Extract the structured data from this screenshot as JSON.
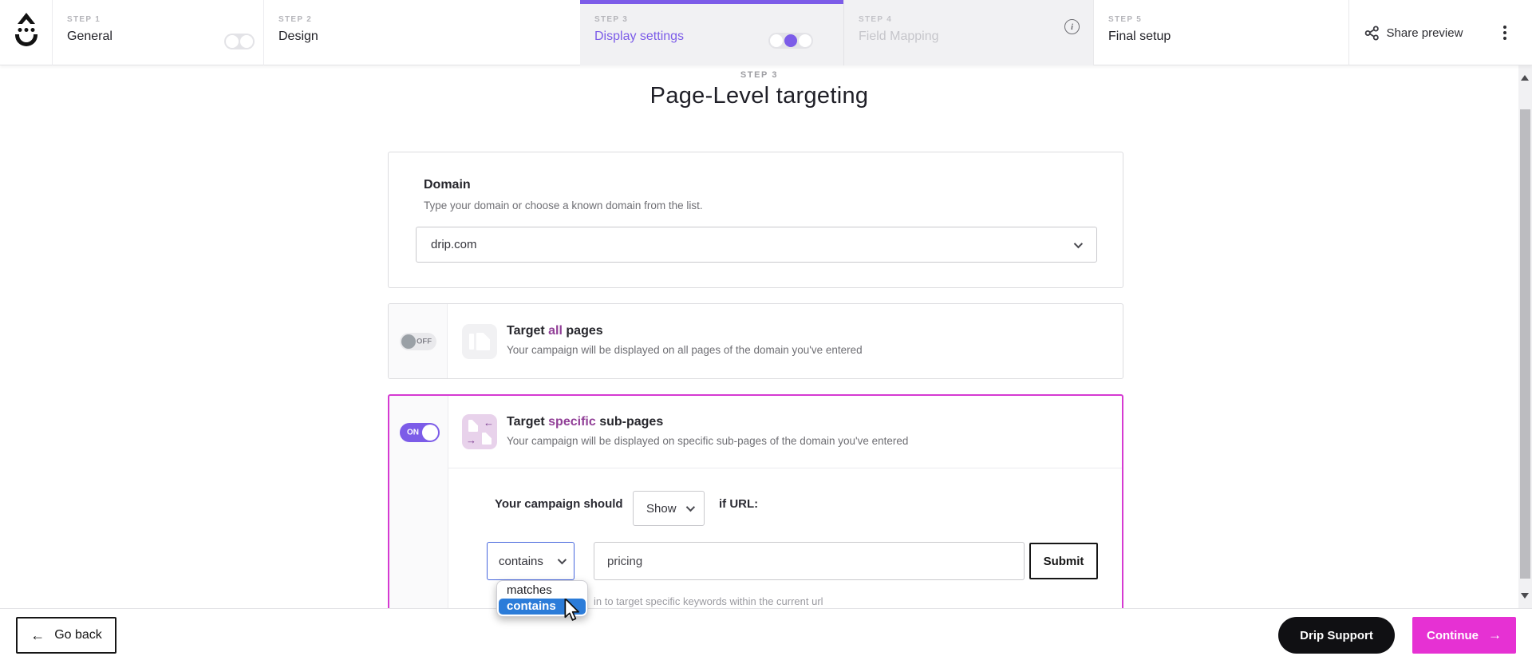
{
  "header": {
    "steps": [
      {
        "step": "STEP 1",
        "label": "General"
      },
      {
        "step": "STEP 2",
        "label": "Design"
      },
      {
        "step": "STEP 3",
        "label": "Display settings"
      },
      {
        "step": "STEP 4",
        "label": "Field Mapping"
      },
      {
        "step": "STEP 5",
        "label": "Final setup"
      }
    ],
    "share_preview_label": "Share preview"
  },
  "page": {
    "step_eyebrow": "STEP 3",
    "title": "Page-Level targeting"
  },
  "domain_card": {
    "title": "Domain",
    "description": "Type your domain or choose a known domain from the list.",
    "selected_domain": "drip.com"
  },
  "all_pages_card": {
    "toggle_state": "OFF",
    "title_prefix": "Target ",
    "title_highlight": "all",
    "title_suffix": " pages",
    "description": "Your campaign will be displayed on all pages of the domain you've entered"
  },
  "specific_pages_card": {
    "toggle_state": "ON",
    "title_prefix": "Target ",
    "title_highlight": "specific",
    "title_suffix": " sub-pages",
    "description": "Your campaign will be displayed on specific sub-pages of the domain you've entered",
    "rule_label": "Your campaign should",
    "show_value": "Show",
    "if_url_label": "if URL:",
    "condition_value": "contains",
    "url_value": "pricing",
    "submit_label": "Submit",
    "dropdown_options": [
      "matches",
      "contains"
    ],
    "dropdown_selected": "contains",
    "helper_text_visible": "in to target specific keywords within the current url"
  },
  "footer": {
    "go_back_label": "Go back",
    "support_label": "Drip Support",
    "continue_label": "Continue"
  },
  "icons": {
    "logo": "drip-logo",
    "share": "share-icon",
    "step4_info": "info-icon",
    "overflow_menu": "kebab-menu-icon",
    "selects": "chevron-down-icon",
    "go_back_arrow": "arrow-left-icon",
    "continue_arrow": "arrow-right-icon",
    "pointer": "mouse-cursor"
  },
  "colors": {
    "accent_purple": "#7c5ce8",
    "active_card_border": "#d53ad2",
    "continue_button": "#e631d3",
    "title_highlight": "#913f97",
    "dropdown_selection_blue": "#2b7cd9"
  }
}
